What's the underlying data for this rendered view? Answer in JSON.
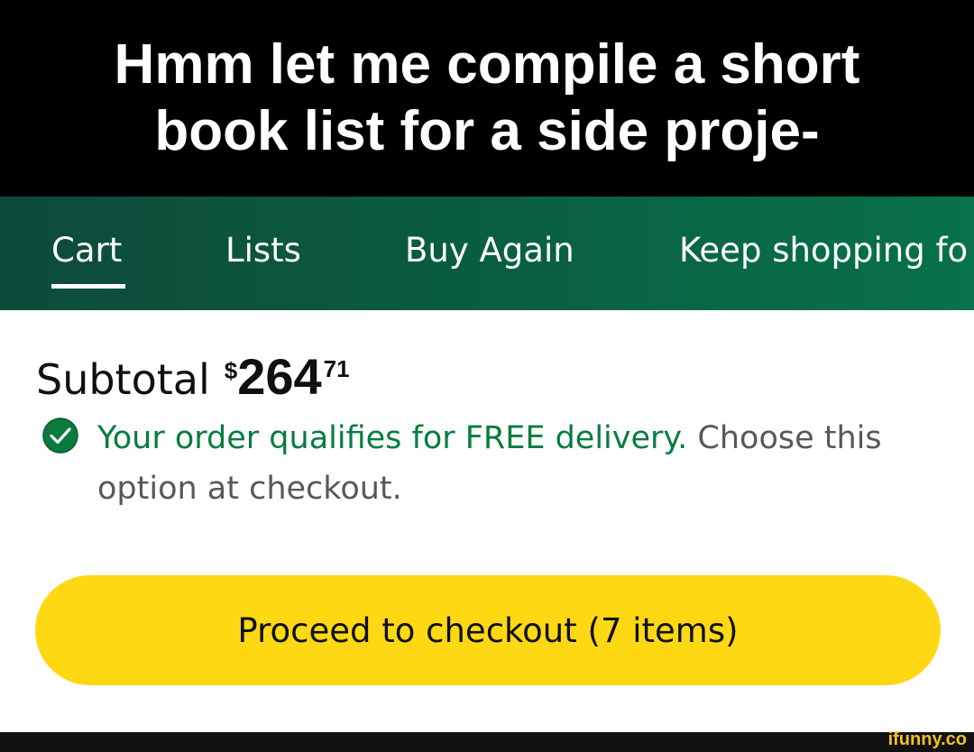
{
  "caption": {
    "line1": "Hmm let me compile a short",
    "line2": "book list for a side proje-"
  },
  "nav": {
    "tabs": [
      {
        "label": "Cart",
        "active": true
      },
      {
        "label": "Lists",
        "active": false
      },
      {
        "label": "Buy Again",
        "active": false
      },
      {
        "label": "Keep shopping fo",
        "active": false
      }
    ]
  },
  "subtotal": {
    "label": "Subtotal",
    "currency": "$",
    "whole": "264",
    "fraction": "71"
  },
  "delivery": {
    "icon": "check-circle-icon",
    "highlight": "Your order qualifies for FREE delivery.",
    "rest": " Choose this option at checkout."
  },
  "checkout": {
    "label": "Proceed to checkout (7 items)"
  },
  "watermark": {
    "text": "ifunny.co"
  },
  "colors": {
    "caption_bg": "#000000",
    "nav_bg_start": "#0e4a3a",
    "nav_bg_end": "#087248",
    "delivery_green": "#067d3e",
    "check_fill": "#0a7b3e",
    "button_yellow": "#ffd814",
    "watermark_yellow": "#f2c21b"
  }
}
